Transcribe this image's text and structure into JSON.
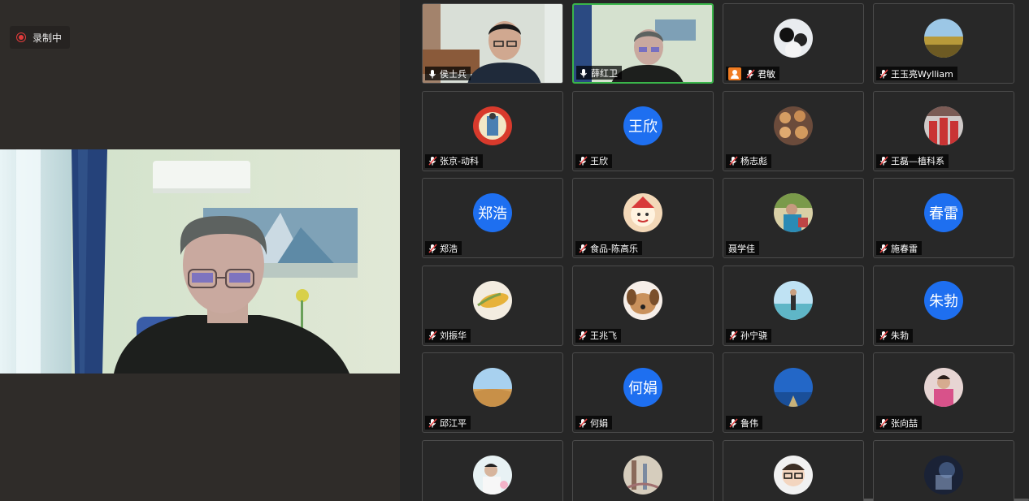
{
  "recording": {
    "label": "录制中"
  },
  "participants": [
    {
      "name": "侯士兵",
      "kind": "video",
      "mic": "on"
    },
    {
      "name": "薛红卫",
      "kind": "video",
      "mic": "on",
      "active": true
    },
    {
      "name": "君敏",
      "kind": "photo",
      "mic": "off",
      "cam": "off",
      "photo": "panda"
    },
    {
      "name": "王玉亮Wylliam",
      "kind": "photo",
      "mic": "off",
      "photo": "field"
    },
    {
      "name": "张京-动科",
      "kind": "photo",
      "mic": "off",
      "photo": "badge"
    },
    {
      "name": "王欣",
      "kind": "text",
      "avatar": "王欣",
      "mic": "off"
    },
    {
      "name": "杨志彪",
      "kind": "photo",
      "mic": "off",
      "photo": "food"
    },
    {
      "name": "王磊—植科系",
      "kind": "photo",
      "mic": "off",
      "photo": "group"
    },
    {
      "name": "郑浩",
      "kind": "text",
      "avatar": "郑浩",
      "mic": "off"
    },
    {
      "name": "食品-陈高乐",
      "kind": "photo",
      "mic": "off",
      "photo": "cartoon"
    },
    {
      "name": "聂学佳",
      "kind": "photo",
      "mic": "none",
      "photo": "person"
    },
    {
      "name": "施春雷",
      "kind": "text",
      "avatar": "春雷",
      "mic": "off"
    },
    {
      "name": "刘振华",
      "kind": "photo",
      "mic": "off",
      "photo": "corn"
    },
    {
      "name": "王兆飞",
      "kind": "photo",
      "mic": "off",
      "photo": "dog"
    },
    {
      "name": "孙宁骁",
      "kind": "photo",
      "mic": "off",
      "photo": "beach"
    },
    {
      "name": "朱勃",
      "kind": "text",
      "avatar": "朱勃",
      "mic": "off"
    },
    {
      "name": "邱江平",
      "kind": "photo",
      "mic": "off",
      "photo": "desert"
    },
    {
      "name": "何娟",
      "kind": "text",
      "avatar": "何娟",
      "mic": "off"
    },
    {
      "name": "鲁伟",
      "kind": "photo",
      "mic": "off",
      "photo": "blue"
    },
    {
      "name": "张向喆",
      "kind": "photo",
      "mic": "off",
      "photo": "child"
    },
    {
      "name": "",
      "kind": "photo",
      "mic": "none",
      "photo": "man",
      "partial": true
    },
    {
      "name": "",
      "kind": "photo",
      "mic": "none",
      "photo": "painting",
      "partial": true
    },
    {
      "name": "",
      "kind": "photo",
      "mic": "none",
      "photo": "glasses",
      "partial": true
    },
    {
      "name": "",
      "kind": "photo",
      "mic": "none",
      "photo": "night",
      "partial": true
    }
  ]
}
